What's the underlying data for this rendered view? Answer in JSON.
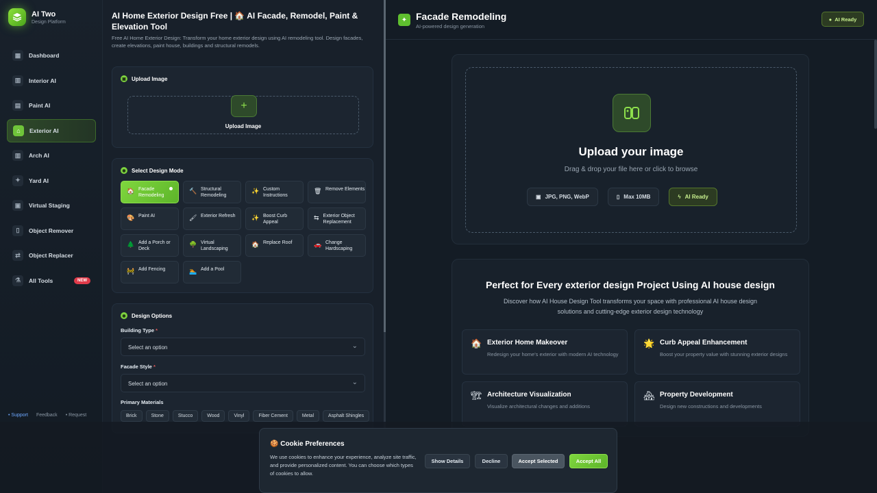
{
  "brand": {
    "title": "AI Two",
    "subtitle": "Design Platform"
  },
  "sidebar": {
    "items": [
      {
        "label": "Dashboard",
        "icon": "grid-icon"
      },
      {
        "label": "Interior AI",
        "icon": "building-icon"
      },
      {
        "label": "Paint AI",
        "icon": "paint-icon"
      },
      {
        "label": "Exterior AI",
        "icon": "house-icon",
        "active": true
      },
      {
        "label": "Arch AI",
        "icon": "arch-icon"
      },
      {
        "label": "Yard AI",
        "icon": "sparkle-icon"
      },
      {
        "label": "Virtual Staging",
        "icon": "image-icon"
      },
      {
        "label": "Object Remover",
        "icon": "trash-icon"
      },
      {
        "label": "Object Replacer",
        "icon": "swap-icon"
      },
      {
        "label": "All Tools",
        "icon": "flask-icon",
        "badge": "NEW"
      }
    ],
    "footer": {
      "support": "Support",
      "feedback": "Feedback",
      "request": "Request"
    }
  },
  "page": {
    "title": "AI Home Exterior Design Free | 🏠 AI Facade, Remodel, Paint & Elevation Tool",
    "description": "Free AI Home Exterior Design: Transform your home exterior design using AI remodeling tool. Design facades, create elevations, paint house, buildings and structural remodels."
  },
  "upload": {
    "heading": "Upload Image",
    "button": "Upload Image",
    "plus": "+"
  },
  "design_mode": {
    "heading": "Select Design Mode",
    "modes": [
      {
        "label": "Facade Remodeling",
        "icon": "🏠",
        "active": true
      },
      {
        "label": "Structural Remodeling",
        "icon": "🔨"
      },
      {
        "label": "Custom Instructions",
        "icon": "✨"
      },
      {
        "label": "Remove Elements",
        "icon": "🗑"
      },
      {
        "label": "Paint AI",
        "icon": "🎨"
      },
      {
        "label": "Exterior Refresh",
        "icon": "🖌"
      },
      {
        "label": "Boost Curb Appeal",
        "icon": "✨"
      },
      {
        "label": "Exterior Object Replacement",
        "icon": "⇆"
      },
      {
        "label": "Add a Porch or Deck",
        "icon": "🌲"
      },
      {
        "label": "Virtual Landscaping",
        "icon": "🌳"
      },
      {
        "label": "Replace Roof",
        "icon": "🏠"
      },
      {
        "label": "Change Hardscaping",
        "icon": "🚗"
      },
      {
        "label": "Add Fencing",
        "icon": "🚧"
      },
      {
        "label": "Add a Pool",
        "icon": "🏊"
      }
    ]
  },
  "design_options": {
    "heading": "Design Options",
    "building_type": {
      "label": "Building Type",
      "required": "*",
      "value": "Select an option"
    },
    "facade_style": {
      "label": "Facade Style",
      "required": "*",
      "value": "Select an option"
    },
    "primary_materials": {
      "label": "Primary Materials",
      "options": [
        "Brick",
        "Stone",
        "Stucco",
        "Wood",
        "Vinyl",
        "Fiber Cement",
        "Metal",
        "Asphalt Shingles"
      ]
    }
  },
  "right_header": {
    "title": "Facade Remodeling",
    "subtitle": "AI-powered design generation",
    "status": "AI Ready"
  },
  "upload_area": {
    "title": "Upload your image",
    "subtitle": "Drag & drop your file here or click to browse",
    "pills": [
      "JPG, PNG, WebP",
      "Max 10MB",
      "AI Ready"
    ]
  },
  "features": {
    "title": "Perfect for Every exterior design Project Using AI house design",
    "subtitle": "Discover how AI House Design Tool transforms your space with professional AI house design solutions and cutting-edge exterior design technology",
    "items": [
      {
        "icon": "🏠",
        "title": "Exterior Home Makeover",
        "desc": "Redesign your home's exterior with modern AI technology"
      },
      {
        "icon": "🌟",
        "title": "Curb Appeal Enhancement",
        "desc": "Boost your property value with stunning exterior designs"
      },
      {
        "icon": "🏗",
        "title": "Architecture Visualization",
        "desc": "Visualize architectural changes and additions"
      },
      {
        "icon": "🏘",
        "title": "Property Development",
        "desc": "Design new constructions and developments"
      }
    ]
  },
  "cookie": {
    "title": "🍪 Cookie Preferences",
    "text": "We use cookies to enhance your experience, analyze site traffic, and provide personalized content. You can choose which types of cookies to allow.",
    "buttons": {
      "details": "Show Details",
      "decline": "Decline",
      "selected": "Accept Selected",
      "all": "Accept All"
    }
  }
}
